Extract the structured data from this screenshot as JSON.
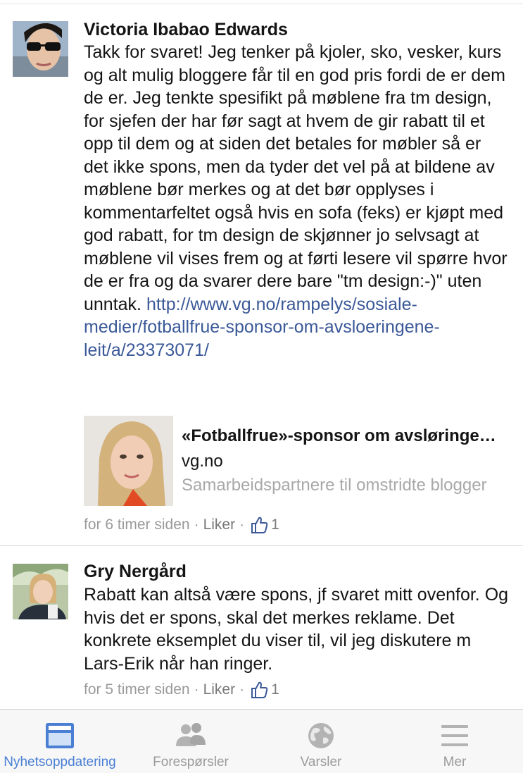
{
  "comments": [
    {
      "author": "Victoria Ibabao Edwards",
      "text": "Takk for svaret! Jeg tenker på kjoler, sko, vesker, kurs og alt mulig bloggere får til en god pris fordi de er dem de er. Jeg tenkte spesifikt på møblene fra tm design, for sjefen der har før sagt at hvem de gir rabatt til et opp til dem og at siden det betales for møbler så er det ikke spons, men da tyder det vel på at bildene av møblene bør merkes og at det bør opplyses i kommentarfeltet også hvis en sofa (feks) er kjøpt med god rabatt, for tm design de skjønner jo selvsagt at møblene vil vises frem og at førti lesere vil spørre hvor de er fra og da svarer dere bare \"tm design:-)\" uten unntak.",
      "link": "http://www.vg.no/rampelys/sosiale-medier/fotballfrue-sponsor-om-avsloeringene-leit/a/23373071/",
      "preview": {
        "title": "«Fotballfrue»-sponsor om avsløringene leit",
        "domain": "vg.no",
        "description": "Samarbeidspartnere til omstridte blogger"
      },
      "time": "for 6 timer siden",
      "like_label": "Liker",
      "likes": "1"
    },
    {
      "author": "Gry Nergård",
      "text": "Rabatt kan altså være spons, jf svaret mitt ovenfor. Og hvis det er spons, skal det merkes reklame. Det konkrete eksemplet du viser til, vil jeg diskutere m Lars-Erik når han ringer.",
      "time": "for 5 timer siden",
      "like_label": "Liker",
      "likes": "1"
    }
  ],
  "tabs": [
    {
      "label": "Nyhetsoppdatering",
      "icon": "news-feed-icon",
      "active": true
    },
    {
      "label": "Forespørsler",
      "icon": "friend-requests-icon",
      "active": false
    },
    {
      "label": "Varsler",
      "icon": "globe-icon",
      "active": false
    },
    {
      "label": "Mer",
      "icon": "menu-icon",
      "active": false
    }
  ],
  "colors": {
    "link": "#3b5998",
    "active_tab": "#4a7fd4",
    "inactive_tab": "#9b9b9b",
    "meta_text": "#9a9a9a"
  }
}
